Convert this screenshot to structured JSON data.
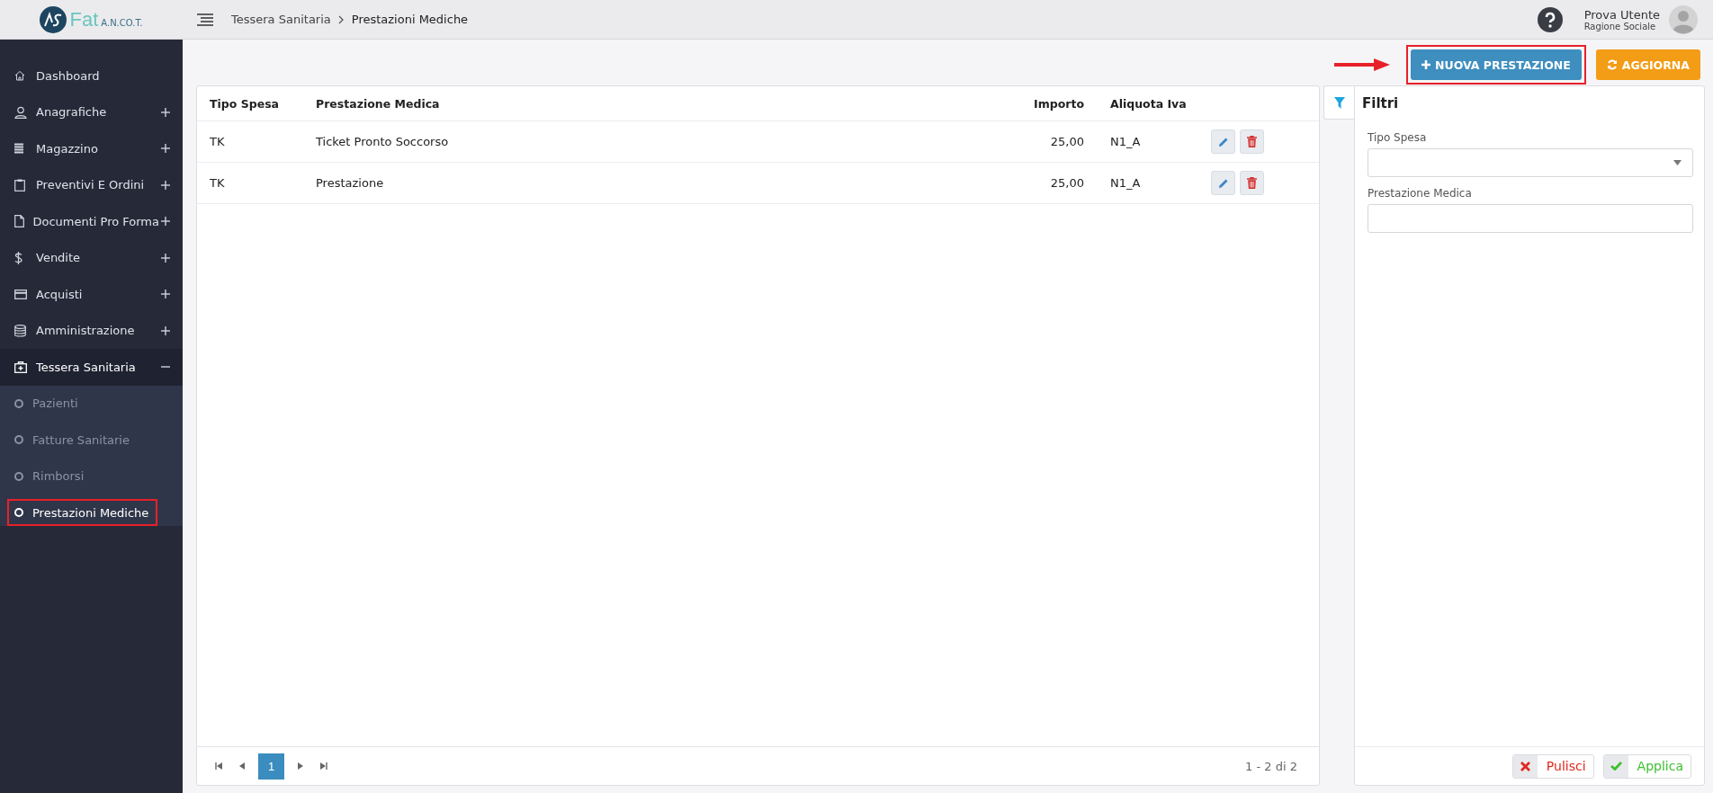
{
  "logo": {
    "name": "Fat",
    "suffix": "A.N.CO.T."
  },
  "breadcrumb": [
    "Tessera Sanitaria",
    "Prestazioni Mediche"
  ],
  "user": {
    "name": "Prova Utente",
    "company": "Ragione Sociale"
  },
  "sidebar": {
    "items": [
      {
        "label": "Dashboard"
      },
      {
        "label": "Anagrafiche",
        "expanded": false
      },
      {
        "label": "Magazzino",
        "expanded": false
      },
      {
        "label": "Preventivi E Ordini",
        "expanded": false
      },
      {
        "label": "Documenti Pro Forma",
        "expanded": false
      },
      {
        "label": "Vendite",
        "expanded": false
      },
      {
        "label": "Acquisti",
        "expanded": false
      },
      {
        "label": "Amministrazione",
        "expanded": false
      },
      {
        "label": "Tessera Sanitaria",
        "expanded": true,
        "children": [
          {
            "label": "Pazienti",
            "selected": false,
            "highlighted": false
          },
          {
            "label": "Fatture Sanitarie",
            "selected": false,
            "highlighted": false
          },
          {
            "label": "Rimborsi",
            "selected": false,
            "highlighted": false
          },
          {
            "label": "Prestazioni Mediche",
            "selected": true,
            "highlighted": true
          }
        ]
      }
    ]
  },
  "toolbar": {
    "buttons": [
      {
        "kind": "new",
        "label": "NUOVA PRESTAZIONE",
        "highlighted": true
      },
      {
        "kind": "refresh",
        "label": "AGGIORNA",
        "highlighted": false
      }
    ]
  },
  "table": {
    "columns": [
      "Tipo Spesa",
      "Prestazione Medica",
      "Importo",
      "Aliquota Iva"
    ],
    "rows": [
      [
        "TK",
        "Ticket Pronto Soccorso",
        "25,00",
        "N1_A"
      ],
      [
        "TK",
        "Prestazione",
        "25,00",
        "N1_A"
      ]
    ]
  },
  "pagination": {
    "pages": [
      {
        "label": "1",
        "selected": true
      }
    ],
    "summary": "1 - 2 di 2"
  },
  "filters": {
    "title": "Filtri",
    "fields": [
      {
        "kind": "select",
        "label": "Tipo Spesa"
      },
      {
        "kind": "text",
        "label": "Prestazione Medica"
      }
    ],
    "buttons": [
      {
        "kind": "clear",
        "label": "Pulisci"
      },
      {
        "kind": "apply",
        "label": "Applica"
      }
    ]
  }
}
